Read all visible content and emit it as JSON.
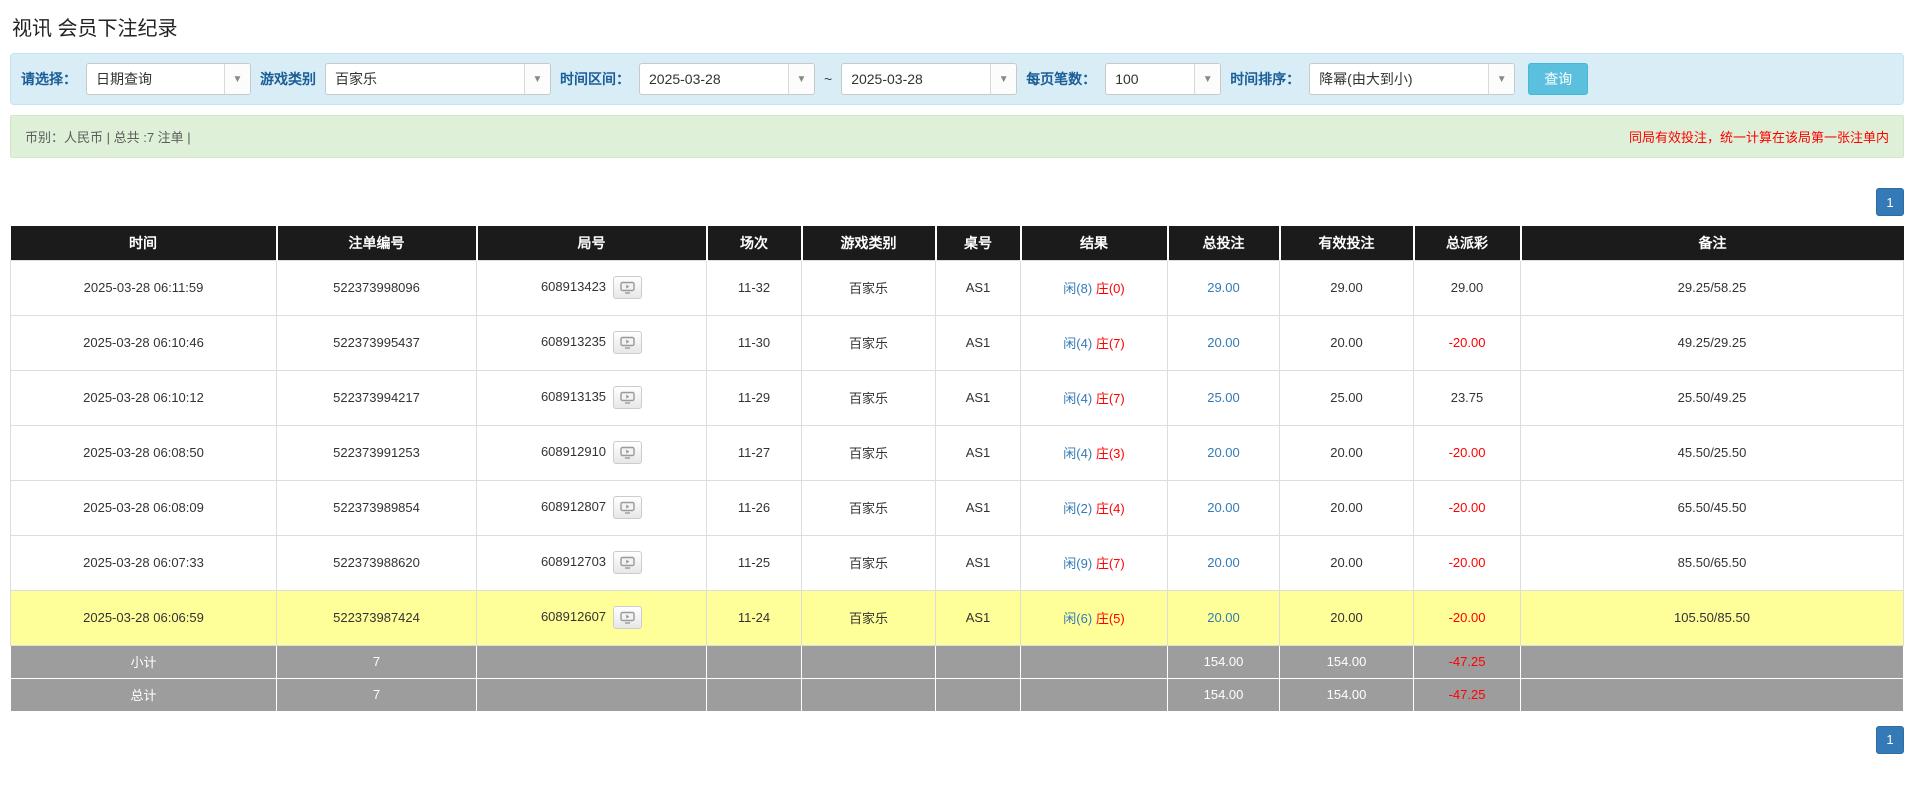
{
  "page": {
    "title": "视讯 会员下注纪录"
  },
  "filters": {
    "select_label": "请选择：",
    "select_value": "日期查询",
    "game_type_label": "游戏类别",
    "game_type_value": "百家乐",
    "time_range_label": "时间区间：",
    "date_from": "2025-03-28",
    "date_tilde": "~",
    "date_to": "2025-03-28",
    "page_size_label": "每页笔数：",
    "page_size_value": "100",
    "sort_label": "时间排序：",
    "sort_value": "降幂(由大到小)",
    "search_button": "查询"
  },
  "summary": {
    "left": "币别：人民币 | 总共 :7 注单 |",
    "right": "同局有效投注，统一计算在该局第一张注单内"
  },
  "pagination": {
    "page": "1"
  },
  "table": {
    "headers": [
      "时间",
      "注单编号",
      "局号",
      "场次",
      "游戏类别",
      "桌号",
      "结果",
      "总投注",
      "有效投注",
      "总派彩",
      "备注"
    ],
    "rows": [
      {
        "time": "2025-03-28 06:11:59",
        "bet_id": "522373998096",
        "round_id": "608913423",
        "session": "11-32",
        "game": "百家乐",
        "table_no": "AS1",
        "result_player": "闲(8)",
        "result_banker": "庄(0)",
        "total_bet": "29.00",
        "valid_bet": "29.00",
        "payout": "29.00",
        "remark": "29.25/58.25",
        "highlight": false
      },
      {
        "time": "2025-03-28 06:10:46",
        "bet_id": "522373995437",
        "round_id": "608913235",
        "session": "11-30",
        "game": "百家乐",
        "table_no": "AS1",
        "result_player": "闲(4)",
        "result_banker": "庄(7)",
        "total_bet": "20.00",
        "valid_bet": "20.00",
        "payout": "-20.00",
        "remark": "49.25/29.25",
        "highlight": false
      },
      {
        "time": "2025-03-28 06:10:12",
        "bet_id": "522373994217",
        "round_id": "608913135",
        "session": "11-29",
        "game": "百家乐",
        "table_no": "AS1",
        "result_player": "闲(4)",
        "result_banker": "庄(7)",
        "total_bet": "25.00",
        "valid_bet": "25.00",
        "payout": "23.75",
        "remark": "25.50/49.25",
        "highlight": false
      },
      {
        "time": "2025-03-28 06:08:50",
        "bet_id": "522373991253",
        "round_id": "608912910",
        "session": "11-27",
        "game": "百家乐",
        "table_no": "AS1",
        "result_player": "闲(4)",
        "result_banker": "庄(3)",
        "total_bet": "20.00",
        "valid_bet": "20.00",
        "payout": "-20.00",
        "remark": "45.50/25.50",
        "highlight": false
      },
      {
        "time": "2025-03-28 06:08:09",
        "bet_id": "522373989854",
        "round_id": "608912807",
        "session": "11-26",
        "game": "百家乐",
        "table_no": "AS1",
        "result_player": "闲(2)",
        "result_banker": "庄(4)",
        "total_bet": "20.00",
        "valid_bet": "20.00",
        "payout": "-20.00",
        "remark": "65.50/45.50",
        "highlight": false
      },
      {
        "time": "2025-03-28 06:07:33",
        "bet_id": "522373988620",
        "round_id": "608912703",
        "session": "11-25",
        "game": "百家乐",
        "table_no": "AS1",
        "result_player": "闲(9)",
        "result_banker": "庄(7)",
        "total_bet": "20.00",
        "valid_bet": "20.00",
        "payout": "-20.00",
        "remark": "85.50/65.50",
        "highlight": false
      },
      {
        "time": "2025-03-28 06:06:59",
        "bet_id": "522373987424",
        "round_id": "608912607",
        "session": "11-24",
        "game": "百家乐",
        "table_no": "AS1",
        "result_player": "闲(6)",
        "result_banker": "庄(5)",
        "total_bet": "20.00",
        "valid_bet": "20.00",
        "payout": "-20.00",
        "remark": "105.50/85.50",
        "highlight": true
      }
    ],
    "subtotal": {
      "label": "小计",
      "count": "7",
      "total_bet": "154.00",
      "valid_bet": "154.00",
      "payout": "-47.25"
    },
    "total": {
      "label": "总计",
      "count": "7",
      "total_bet": "154.00",
      "valid_bet": "154.00",
      "payout": "-47.25"
    }
  }
}
